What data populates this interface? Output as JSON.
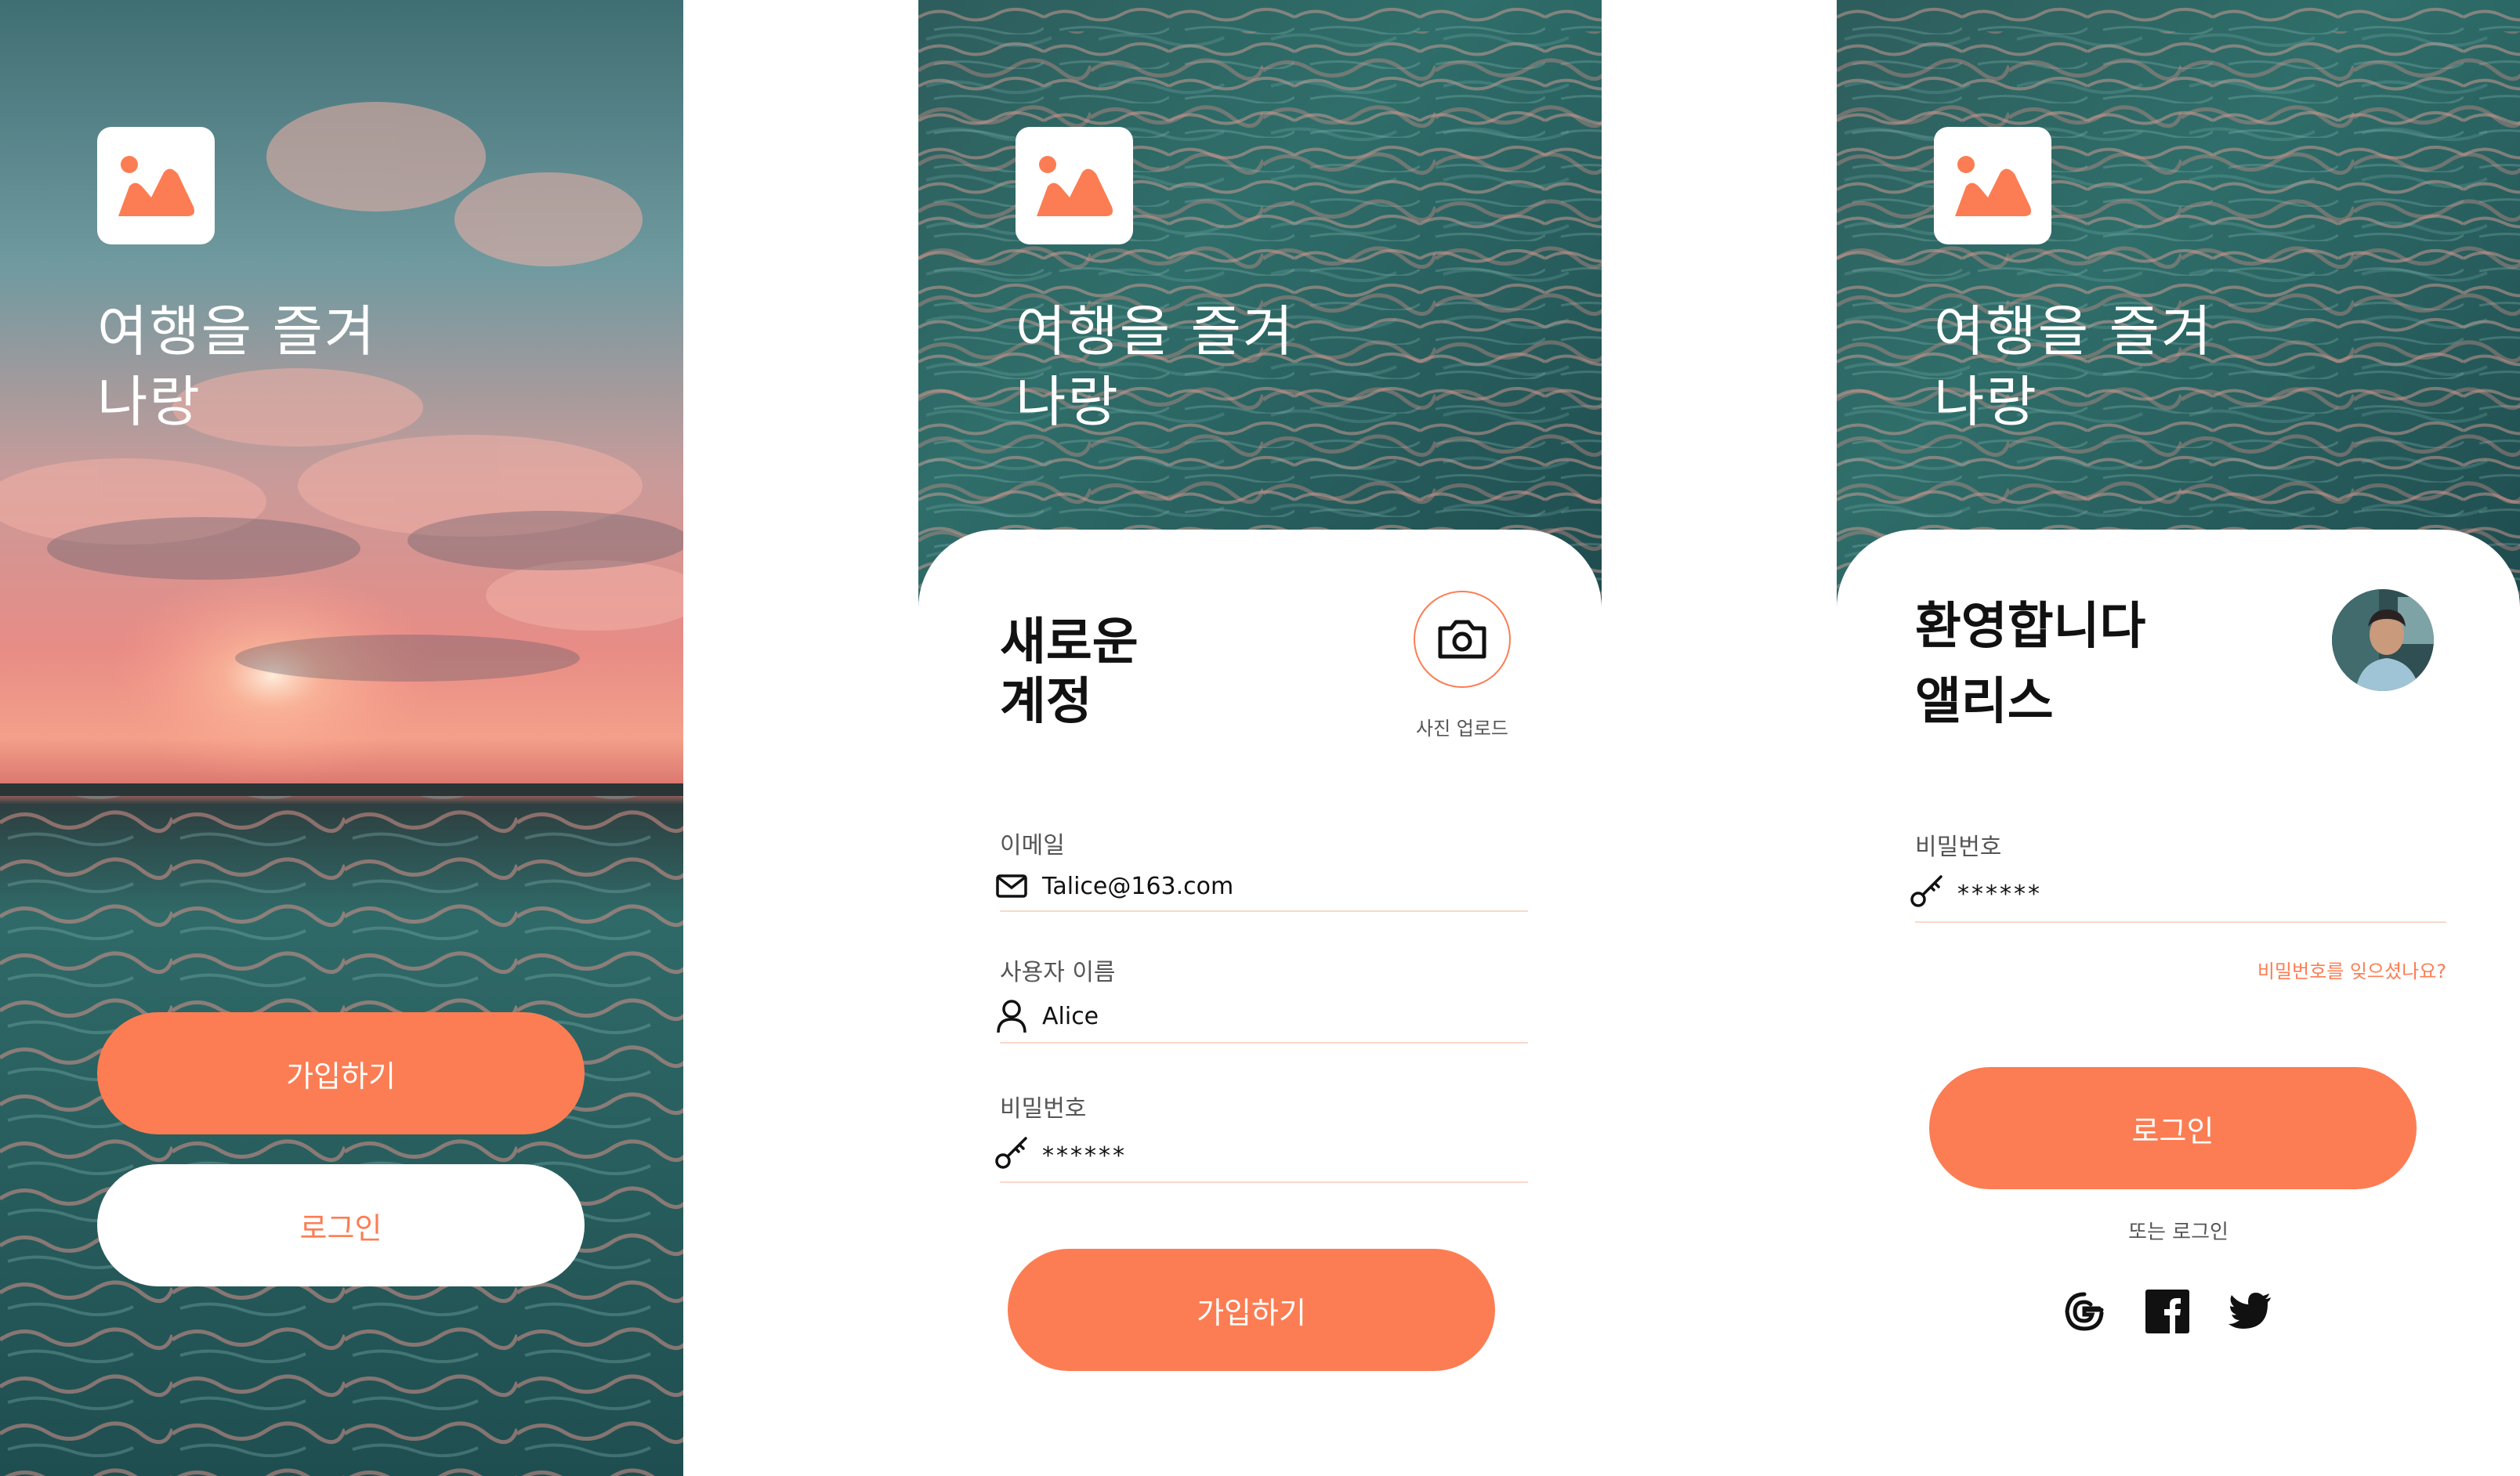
{
  "app": {
    "hero_line1": "여행을 즐겨",
    "hero_line2": "나랑",
    "accent_color": "#FC7D53"
  },
  "welcome": {
    "signup_button": "가입하기",
    "login_button": "로그인"
  },
  "signup": {
    "title_line1": "새로운",
    "title_line2": "계정",
    "upload_caption": "사진 업로드",
    "email_label": "이메일",
    "email_value": "Talice@163.com",
    "username_label": "사용자 이름",
    "username_value": "Alice",
    "password_label": "비밀번호",
    "password_value": "******",
    "submit_button": "가입하기"
  },
  "login": {
    "title_line1": "환영합니다",
    "title_line2": "앨리스",
    "password_label": "비밀번호",
    "password_value": "******",
    "forgot_link": "비밀번호를 잊으셨나요?",
    "login_button": "로그인",
    "or_login": "또는 로그인",
    "social_icons": [
      "google-icon",
      "facebook-icon",
      "twitter-icon"
    ]
  }
}
